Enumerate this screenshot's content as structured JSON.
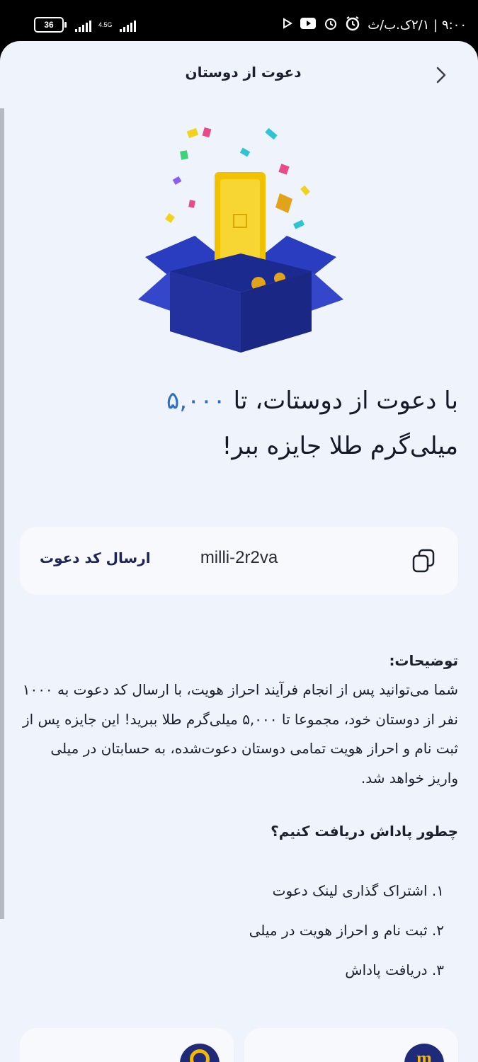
{
  "status_bar": {
    "time": "۹:۰۰ | ۲/۱ک.ب/ث",
    "battery": "36",
    "network": "4.5G",
    "icons": [
      "play-icon",
      "youtube-icon",
      "alarm-icon",
      "alarm-clock-icon"
    ]
  },
  "header": {
    "title": "دعوت از دوستان",
    "back_icon": "chevron-right-icon"
  },
  "hero": {
    "illustration": "gift-box-with-gold-bar",
    "colors": {
      "box": "#2433a0",
      "gold": "#f2c200"
    }
  },
  "headline": {
    "part1": "با دعوت از دوستات، تا ",
    "amount": "۵,۰۰۰",
    "part2": "میلی‌گرم طلا جایزه ببر!",
    "accent_color": "#2e6ec2"
  },
  "invite": {
    "code": "milli-2r2va",
    "send_label": "ارسال کد دعوت",
    "copy_icon": "copy-icon"
  },
  "description": {
    "title": "توضیحات:",
    "body": "شما می‌توانید پس از انجام فرآیند احراز هویت، با ارسال کد دعوت به ۱۰۰۰ نفر از دوستان خود، مجموعا تا ۵,۰۰۰ میلی‌گرم طلا ببرید! این جایزه پس از ثبت نام و احراز هویت تمامی دوستان دعوت‌شده، به حسابتان در میلی واریز خواهد شد."
  },
  "how_to": {
    "title": "چطور پاداش دریافت کنیم؟",
    "steps": [
      "۱. اشتراک گذاری لینک دعوت",
      "۲. ثبت نام و احراز هویت در میلی",
      "۳. دریافت پاداش"
    ]
  },
  "bottom_cards": [
    "coin-icon",
    "milli-logo-icon"
  ]
}
